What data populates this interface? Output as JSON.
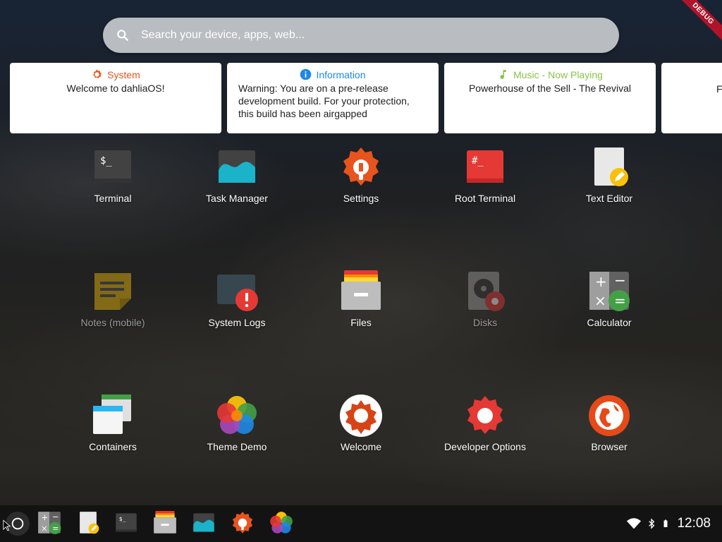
{
  "search": {
    "placeholder": "Search your device, apps, web..."
  },
  "debug_banner": "DEBUG",
  "notifications": [
    {
      "title": "System",
      "icon": "gear-icon",
      "color": "#e8541d",
      "body": "Welcome to dahliaOS!"
    },
    {
      "title": "Information",
      "icon": "info-icon",
      "color": "#1e88e5",
      "body": "Warning: You are on a pre-release development build. For your protection, this build has been airgapped"
    },
    {
      "title": "Music - Now Playing",
      "icon": "music-note-icon",
      "color": "#8bc34a",
      "body": "Powerhouse of the Sell - The Revival"
    },
    {
      "title": "",
      "icon": "",
      "color": "",
      "body": "F"
    }
  ],
  "apps": [
    {
      "label": "Terminal",
      "icon": "terminal-icon",
      "enabled": true
    },
    {
      "label": "Task Manager",
      "icon": "task-manager-icon",
      "enabled": true
    },
    {
      "label": "Settings",
      "icon": "settings-icon",
      "enabled": true
    },
    {
      "label": "Root Terminal",
      "icon": "root-terminal-icon",
      "enabled": true
    },
    {
      "label": "Text Editor",
      "icon": "text-editor-icon",
      "enabled": true
    },
    {
      "label": "Notes (mobile)",
      "icon": "notes-icon",
      "enabled": false
    },
    {
      "label": "System Logs",
      "icon": "system-logs-icon",
      "enabled": true
    },
    {
      "label": "Files",
      "icon": "files-icon",
      "enabled": true
    },
    {
      "label": "Disks",
      "icon": "disks-icon",
      "enabled": false
    },
    {
      "label": "Calculator",
      "icon": "calculator-icon",
      "enabled": true
    },
    {
      "label": "Containers",
      "icon": "containers-icon",
      "enabled": true
    },
    {
      "label": "Theme Demo",
      "icon": "theme-demo-icon",
      "enabled": true
    },
    {
      "label": "Welcome",
      "icon": "welcome-icon",
      "enabled": true
    },
    {
      "label": "Developer Options",
      "icon": "developer-options-icon",
      "enabled": true
    },
    {
      "label": "Browser",
      "icon": "browser-icon",
      "enabled": true
    }
  ],
  "taskbar": {
    "launcher_icon": "circle-launcher-icon",
    "pinned": [
      "calculator-icon",
      "text-editor-icon",
      "terminal-icon",
      "files-icon",
      "task-manager-icon",
      "settings-icon",
      "theme-demo-icon"
    ],
    "status": {
      "wifi_icon": "wifi-icon",
      "bluetooth_icon": "bluetooth-icon",
      "battery_icon": "battery-icon",
      "time": "12:08"
    }
  },
  "colors": {
    "accent_orange": "#e8541d",
    "info_blue": "#1e88e5",
    "music_green": "#8bc34a",
    "search_bg": "#b9bcc0"
  }
}
